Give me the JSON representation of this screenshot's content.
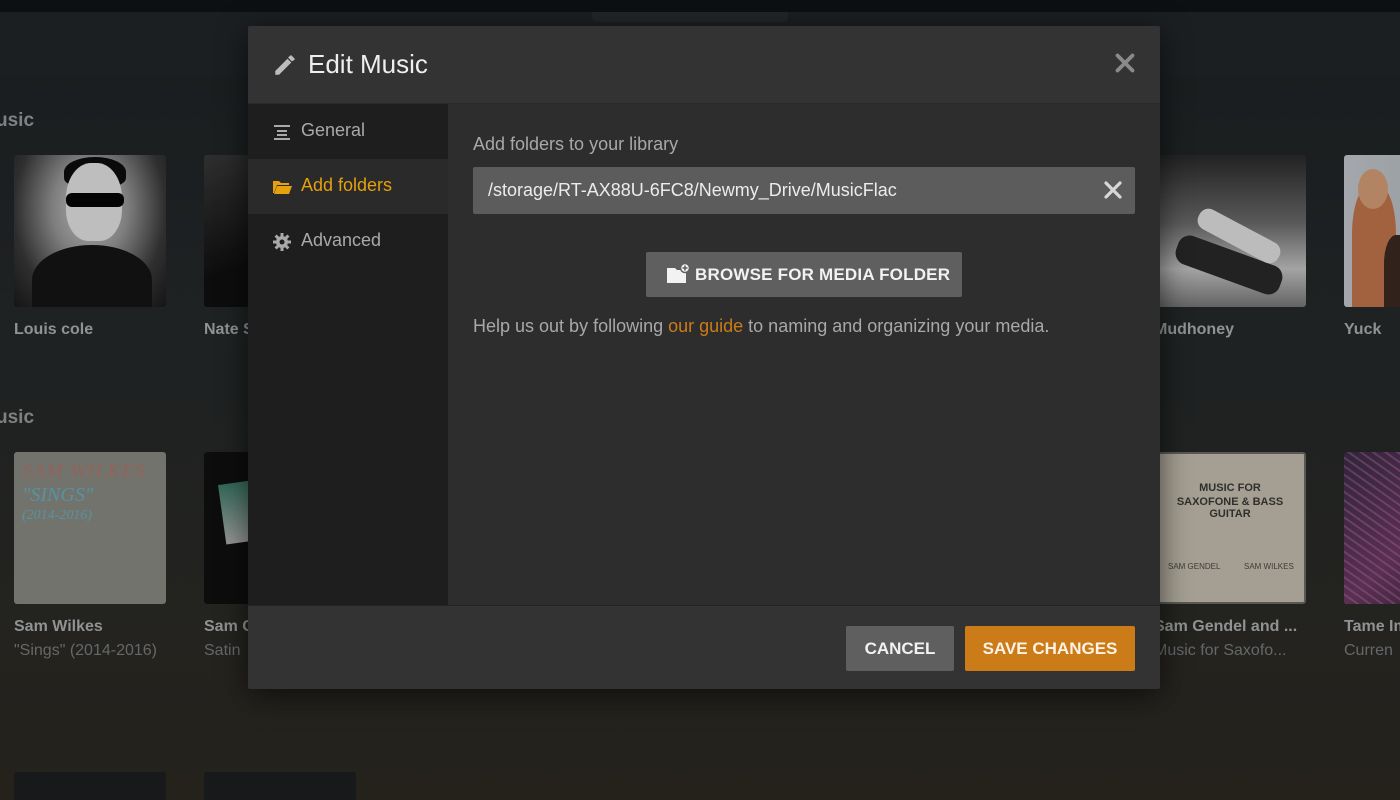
{
  "background": {
    "sections": [
      {
        "title": "usic"
      },
      {
        "title": "usic"
      }
    ],
    "row1": [
      {
        "name": "Louis cole",
        "art": "portrait-sunglasses"
      },
      {
        "name": "Nate S",
        "art": "dark-photo"
      },
      {
        "name": "Mudhoney",
        "art": "guitarist-bw"
      },
      {
        "name": "Yuck",
        "art": "band-photo"
      }
    ],
    "row2": [
      {
        "name": "Sam Wilkes",
        "sub": "\"Sings\" (2014-2016)",
        "art": "album-sings",
        "art_text": [
          "SAM WILKES",
          "\"SINGS\"",
          "(2014-2016)"
        ]
      },
      {
        "name": "Sam G",
        "sub": "Satin",
        "art": "album-satin"
      },
      {
        "name": "Sam Gendel and ...",
        "sub": "Music for Saxofo...",
        "art": "album-music-for",
        "art_text": [
          "MUSIC FOR",
          "SAXOFONE & BASS GUITAR",
          "SAM GENDEL",
          "SAM WILKES"
        ]
      },
      {
        "name": "Tame Im",
        "sub": "Curren",
        "art": "album-currents"
      }
    ]
  },
  "modal": {
    "title": "Edit Music",
    "title_icon": "pencil-icon",
    "close_icon": "close-icon",
    "sidebar": {
      "items": [
        {
          "label": "General",
          "icon": "list-lines-icon",
          "active": false
        },
        {
          "label": "Add folders",
          "icon": "folder-open-icon",
          "active": true
        },
        {
          "label": "Advanced",
          "icon": "gear-icon",
          "active": false
        }
      ]
    },
    "main": {
      "field_label": "Add folders to your library",
      "folder_path": "/storage/RT-AX88U-6FC8/Newmy_Drive/MusicFlac",
      "clear_icon": "clear-x-icon",
      "browse_label": "BROWSE FOR MEDIA FOLDER",
      "browse_icon": "folder-add-icon",
      "help_before": "Help us out by following ",
      "help_link": "our guide",
      "help_after": " to naming and organizing your media."
    },
    "footer": {
      "cancel_label": "CANCEL",
      "save_label": "SAVE CHANGES"
    }
  },
  "colors": {
    "accent": "#e5a00d",
    "save_button": "#cc7b19",
    "modal_bg": "#282828",
    "sidebar_bg": "#1e1e1e"
  }
}
